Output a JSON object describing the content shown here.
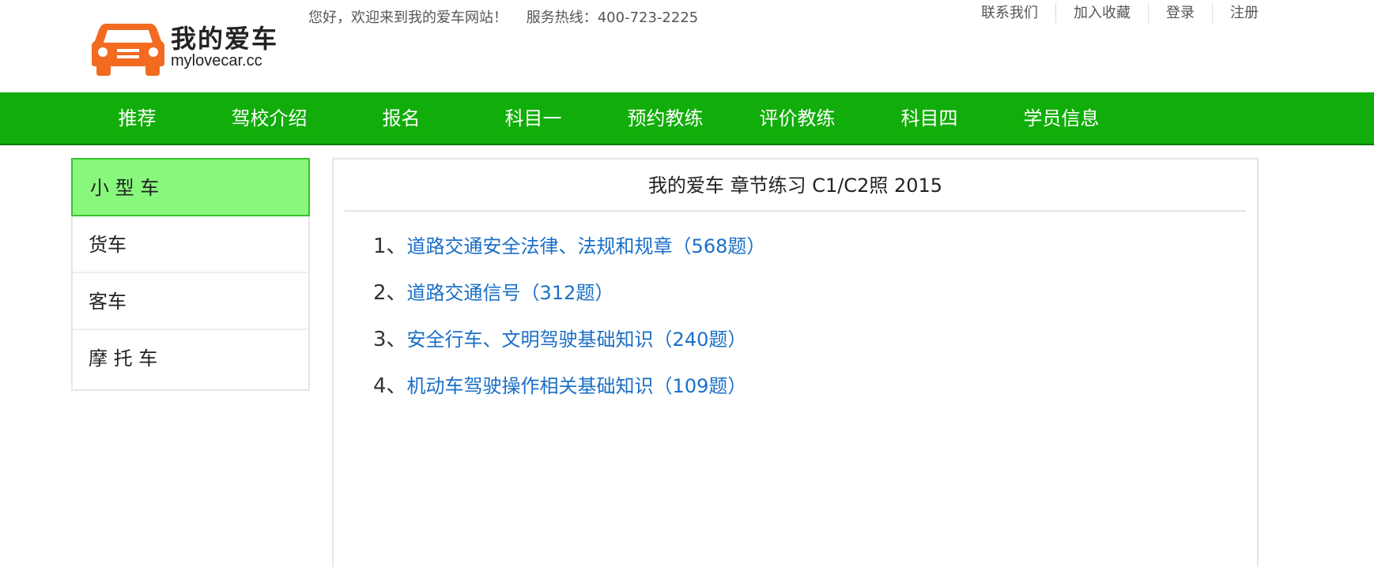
{
  "header": {
    "logo": {
      "title": "我的爱车",
      "subtitle": "mylovecar.cc"
    },
    "welcome_text": "您好，欢迎来到我的爱车网站！",
    "hotline_text": "服务热线：400-723-2225",
    "top_links": [
      "联系我们",
      "加入收藏",
      "登录",
      "注册"
    ]
  },
  "nav": {
    "items": [
      "推荐",
      "驾校介绍",
      "报名",
      "科目一",
      "预约教练",
      "评价教练",
      "科目四",
      "学员信息"
    ]
  },
  "sidebar": {
    "items": [
      {
        "label": "小 型 车",
        "active": true
      },
      {
        "label": "货车",
        "active": false
      },
      {
        "label": "客车",
        "active": false
      },
      {
        "label": "摩 托 车",
        "active": false
      }
    ]
  },
  "main": {
    "title": "我的爱车 章节练习 C1/C2照 2015",
    "chapters": [
      {
        "num": "1、",
        "text": "道路交通安全法律、法规和规章（568题）"
      },
      {
        "num": "2、",
        "text": "道路交通信号（312题）"
      },
      {
        "num": "3、",
        "text": "安全行车、文明驾驶基础知识（240题）"
      },
      {
        "num": "4、",
        "text": "机动车驾驶操作相关基础知识（109题）"
      }
    ]
  },
  "colors": {
    "nav_bg": "#11ad0a",
    "sidebar_active_bg": "#88f87c",
    "link": "#1a6fc7",
    "logo_orange": "#f26b21"
  }
}
